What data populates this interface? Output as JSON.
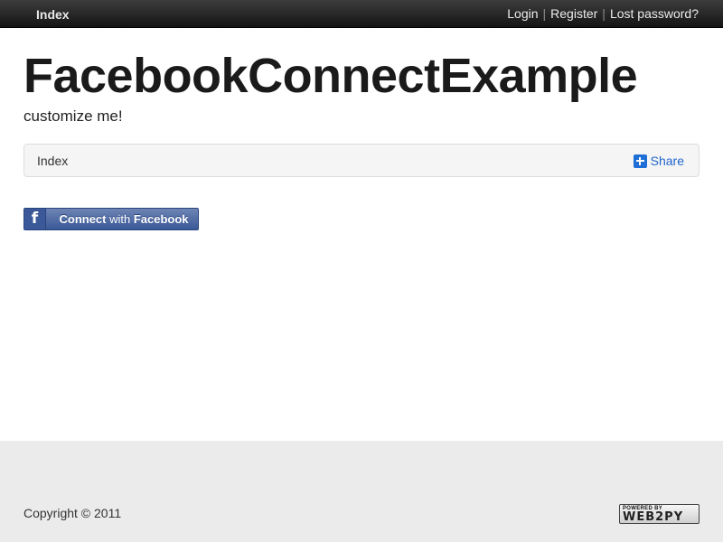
{
  "navbar": {
    "brand": "Index",
    "auth": {
      "login": "Login",
      "separator": "|",
      "register": "Register",
      "lost_password": "Lost password?"
    }
  },
  "header": {
    "title": "FacebookConnectExample",
    "subtitle": "customize me!"
  },
  "breadcrumb": {
    "current": "Index",
    "share_label": "Share"
  },
  "facebook_button": {
    "logo": "f",
    "label_bold": "Connect",
    "label_light": " with ",
    "label_brand": "Facebook"
  },
  "footer": {
    "copyright": "Copyright © 2011",
    "powered_by_top": "POWERED BY",
    "powered_by_main": "WEB2PY"
  },
  "colors": {
    "navbar": "#222222",
    "facebook": "#3b5998",
    "share": "#1f6fd6",
    "footer": "#ebebeb"
  }
}
